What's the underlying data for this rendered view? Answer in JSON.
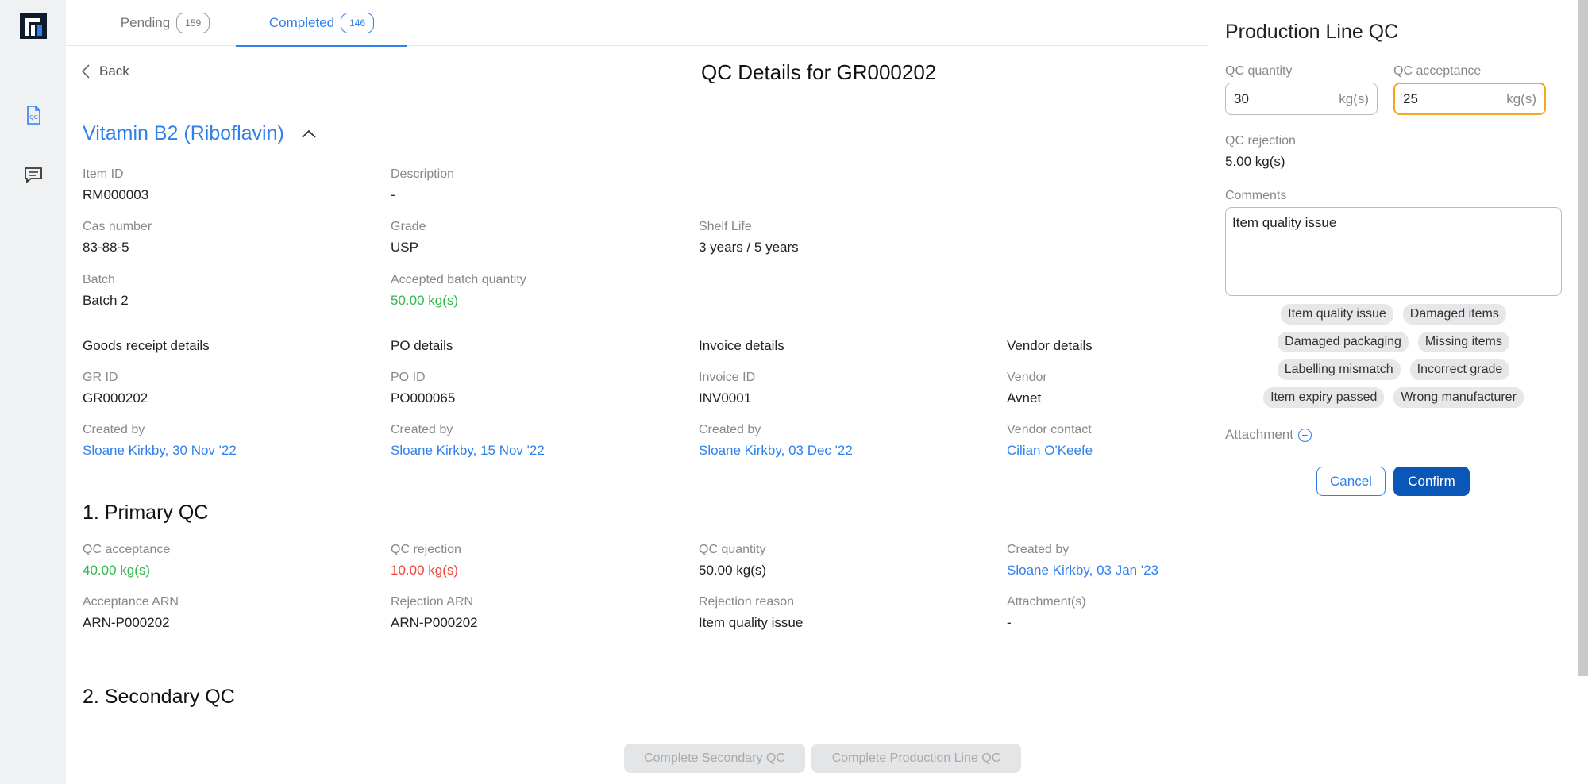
{
  "tabs": [
    {
      "label": "Pending",
      "count": "159"
    },
    {
      "label": "Completed",
      "count": "146"
    }
  ],
  "header": {
    "back_label": "Back",
    "title": "QC Details for GR000202"
  },
  "item": {
    "name": "Vitamin B2 (Riboflavin)",
    "fields": {
      "item_id": {
        "label": "Item ID",
        "value": "RM000003"
      },
      "description": {
        "label": "Description",
        "value": "-"
      },
      "cas": {
        "label": "Cas number",
        "value": "83-88-5"
      },
      "grade": {
        "label": "Grade",
        "value": "USP"
      },
      "shelf": {
        "label": "Shelf Life",
        "value": "3 years / 5 years"
      },
      "batch": {
        "label": "Batch",
        "value": "Batch 2"
      },
      "accepted_batch": {
        "label": "Accepted batch quantity",
        "value": "50.00 kg(s)"
      }
    }
  },
  "details": {
    "gr": {
      "heading": "Goods receipt details",
      "id_label": "GR ID",
      "id_value": "GR000202",
      "created_label": "Created by",
      "created_value": "Sloane Kirkby, 30 Nov '22"
    },
    "po": {
      "heading": "PO details",
      "id_label": "PO ID",
      "id_value": "PO000065",
      "created_label": "Created by",
      "created_value": "Sloane Kirkby, 15 Nov '22"
    },
    "invoice": {
      "heading": "Invoice details",
      "id_label": "Invoice ID",
      "id_value": "INV0001",
      "created_label": "Created by",
      "created_value": "Sloane Kirkby, 03 Dec '22"
    },
    "vendor": {
      "heading": "Vendor details",
      "id_label": "Vendor",
      "id_value": "Avnet",
      "created_label": "Vendor contact",
      "created_value": "Cilian O'Keefe"
    }
  },
  "primary_qc": {
    "title": "1. Primary QC",
    "acceptance": {
      "label": "QC acceptance",
      "value": "40.00 kg(s)"
    },
    "rejection": {
      "label": "QC rejection",
      "value": "10.00 kg(s)"
    },
    "quantity": {
      "label": "QC quantity",
      "value": "50.00 kg(s)"
    },
    "created": {
      "label": "Created by",
      "value": "Sloane Kirkby, 03 Jan '23"
    },
    "acceptance_arn": {
      "label": "Acceptance ARN",
      "value": "ARN-P000202"
    },
    "rejection_arn": {
      "label": "Rejection ARN",
      "value": "ARN-P000202"
    },
    "rejection_reason": {
      "label": "Rejection reason",
      "value": "Item quality issue"
    },
    "attachments": {
      "label": "Attachment(s)",
      "value": "-"
    }
  },
  "secondary_qc": {
    "title": "2. Secondary QC"
  },
  "actions": {
    "complete_secondary": "Complete Secondary QC",
    "complete_production": "Complete Production Line QC"
  },
  "panel": {
    "title": "Production Line QC",
    "qc_quantity_label": "QC quantity",
    "qc_quantity_value": "30",
    "qc_acceptance_label": "QC acceptance",
    "qc_acceptance_value": "25",
    "unit": "kg(s)",
    "qc_rejection_label": "QC rejection",
    "qc_rejection_value": "5.00 kg(s)",
    "comments_label": "Comments",
    "comments_value": "Item quality issue",
    "chips": [
      [
        "Item quality issue",
        "Damaged items"
      ],
      [
        "Damaged packaging",
        "Missing items"
      ],
      [
        "Labelling mismatch",
        "Incorrect grade"
      ],
      [
        "Item expiry passed",
        "Wrong manufacturer"
      ]
    ],
    "attachment_label": "Attachment",
    "cancel_label": "Cancel",
    "confirm_label": "Confirm"
  },
  "colors": {
    "accent": "#2f80ed",
    "confirm": "#0b57b8",
    "success": "#2eb84b",
    "danger": "#f04438",
    "focus": "#f5a623"
  }
}
